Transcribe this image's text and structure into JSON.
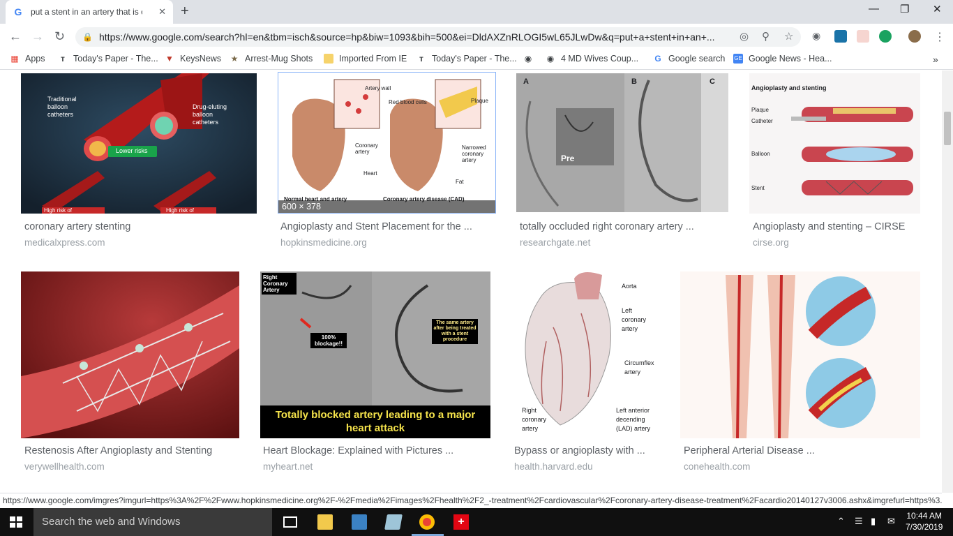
{
  "browser": {
    "tab_title": "put a stent in an artery that is co",
    "url": "https://www.google.com/search?hl=en&tbm=isch&source=hp&biw=1093&bih=500&ei=DldAXZnRLOGI5wL65JLwDw&q=put+a+stent+in+an+...",
    "new_tab": "+",
    "close_tab": "✕",
    "win_min": "—",
    "win_max": "❐",
    "win_close": "✕"
  },
  "bookmarks": [
    {
      "label": "Apps",
      "icon": "apps-grid-icon"
    },
    {
      "label": "Today's Paper - The...",
      "icon": "nyt-icon"
    },
    {
      "label": "KeysNews",
      "icon": "keysnews-icon"
    },
    {
      "label": "Arrest-Mug Shots",
      "icon": "star-icon"
    },
    {
      "label": "Imported From IE",
      "icon": "folder-icon"
    },
    {
      "label": "Today's Paper - The...",
      "icon": "nyt-icon"
    },
    {
      "label": "",
      "icon": "globe-icon"
    },
    {
      "label": "4 MD Wives Coup...",
      "icon": "globe-icon"
    },
    {
      "label": "Google search",
      "icon": "google-icon"
    },
    {
      "label": "Google News - Hea...",
      "icon": "google-news-icon"
    }
  ],
  "results": {
    "row1": [
      {
        "caption": "coronary artery stenting",
        "source": "medicalxpress.com"
      },
      {
        "caption": "Angioplasty and Stent Placement for the ...",
        "source": "hopkinsmedicine.org",
        "dims": "600 × 378"
      },
      {
        "caption": "totally occluded right coronary artery ...",
        "source": "researchgate.net"
      },
      {
        "caption": "Angioplasty and stenting – CIRSE",
        "source": "cirse.org"
      }
    ],
    "row2": [
      {
        "caption": "Restenosis After Angioplasty and Stenting",
        "source": "verywellhealth.com"
      },
      {
        "caption": "Heart Blockage: Explained with Pictures ...",
        "source": "myheart.net"
      },
      {
        "caption": "Bypass or angioplasty with ...",
        "source": "health.harvard.edu"
      },
      {
        "caption": "Peripheral Arterial Disease ...",
        "source": "conehealth.com"
      }
    ]
  },
  "image_text": {
    "img1": {
      "left": "Traditional balloon catheters",
      "right": "Drug-eluting balloon catheters",
      "badge": "Lower risks",
      "bl": "High risk of",
      "br": "High risk of"
    },
    "img2": {
      "artery_wall": "Artery wall",
      "rbc": "Red blood cells",
      "plaque": "Plaque",
      "coronary": "Coronary artery",
      "narrowed": "Narrowed coronary artery",
      "heart": "Heart",
      "fat": "Fat",
      "normal": "Normal heart and artery",
      "cad": "Coronary artery disease (CAD)"
    },
    "img3": {
      "a": "A",
      "b": "B",
      "c": "C",
      "pre": "Pre"
    },
    "img4": {
      "title": "Angioplasty and stenting",
      "plaque": "Plaque",
      "catheter": "Catheter",
      "balloon": "Balloon",
      "stent": "Stent"
    },
    "img6": {
      "label": "Right Coronary Artery",
      "blockage": "100% blockage!!",
      "treated": "The same artery after being treated with a stent procedure",
      "banner": "Totally blocked artery leading to a major heart attack"
    },
    "img7": {
      "aorta": "Aorta",
      "left_cor": "Left coronary artery",
      "circ": "Circumflex artery",
      "right_cor": "Right coronary artery",
      "lad": "Left anterior decending (LAD) artery"
    }
  },
  "status_url": "https://www.google.com/imgres?imgurl=https%3A%2F%2Fwww.hopkinsmedicine.org%2F-%2Fmedia%2Fimages%2Fhealth%2F2_-treatment%2Fcardiovascular%2Fcoronary-artery-disease-treatment%2Facardio20140127v3006.ashx&imgrefurl=https%3...",
  "taskbar": {
    "search_placeholder": "Search the web and Windows",
    "time": "10:44 AM",
    "date": "7/30/2019"
  },
  "colors": {
    "accent": "#4285f4",
    "taskbar": "#101010"
  }
}
